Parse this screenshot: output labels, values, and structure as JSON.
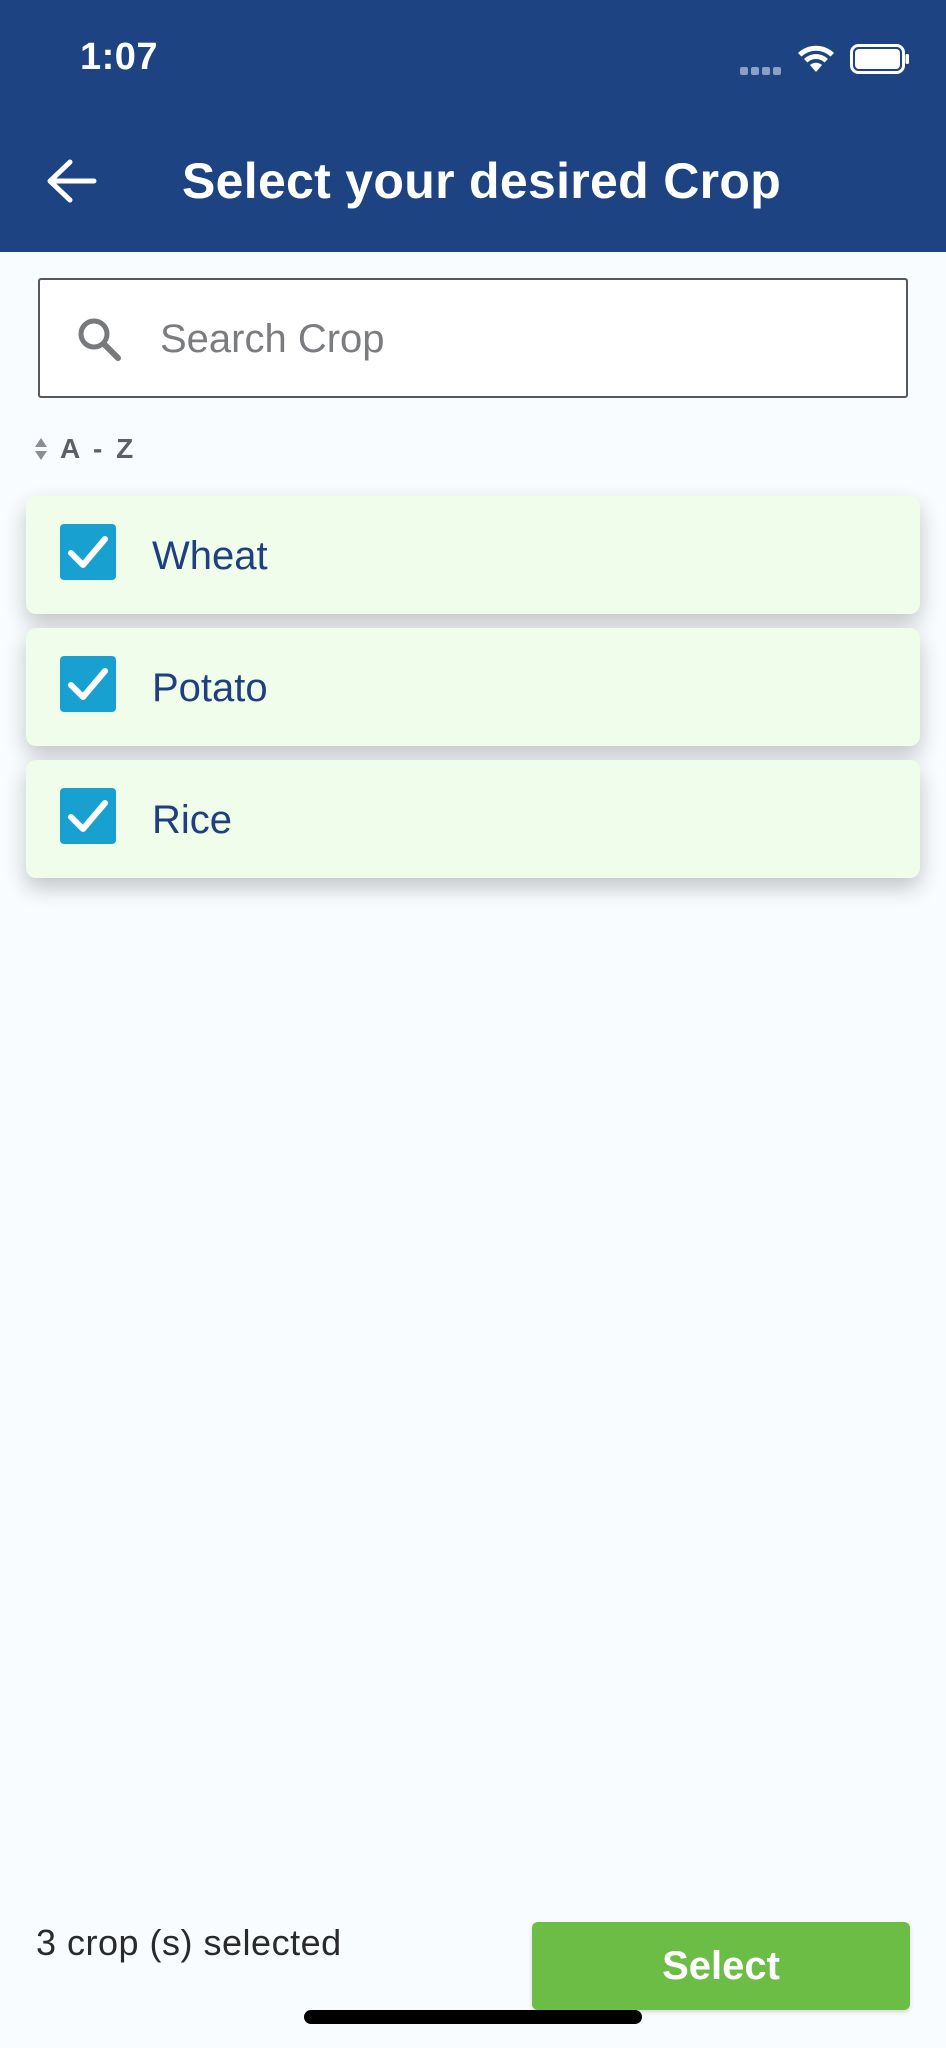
{
  "status_bar": {
    "time": "1:07"
  },
  "header": {
    "title": "Select your desired Crop"
  },
  "search": {
    "placeholder": "Search Crop",
    "value": ""
  },
  "sort": {
    "label": "A - Z"
  },
  "crops": [
    {
      "label": "Wheat",
      "checked": true
    },
    {
      "label": "Potato",
      "checked": true
    },
    {
      "label": "Rice",
      "checked": true
    }
  ],
  "footer": {
    "selected_text": "3 crop (s) selected",
    "select_label": "Select"
  },
  "colors": {
    "header_bg": "#1e4382",
    "item_bg": "#effdea",
    "checkbox": "#18a0d0",
    "button": "#6cbd45",
    "crop_text": "#1f3f7e"
  }
}
